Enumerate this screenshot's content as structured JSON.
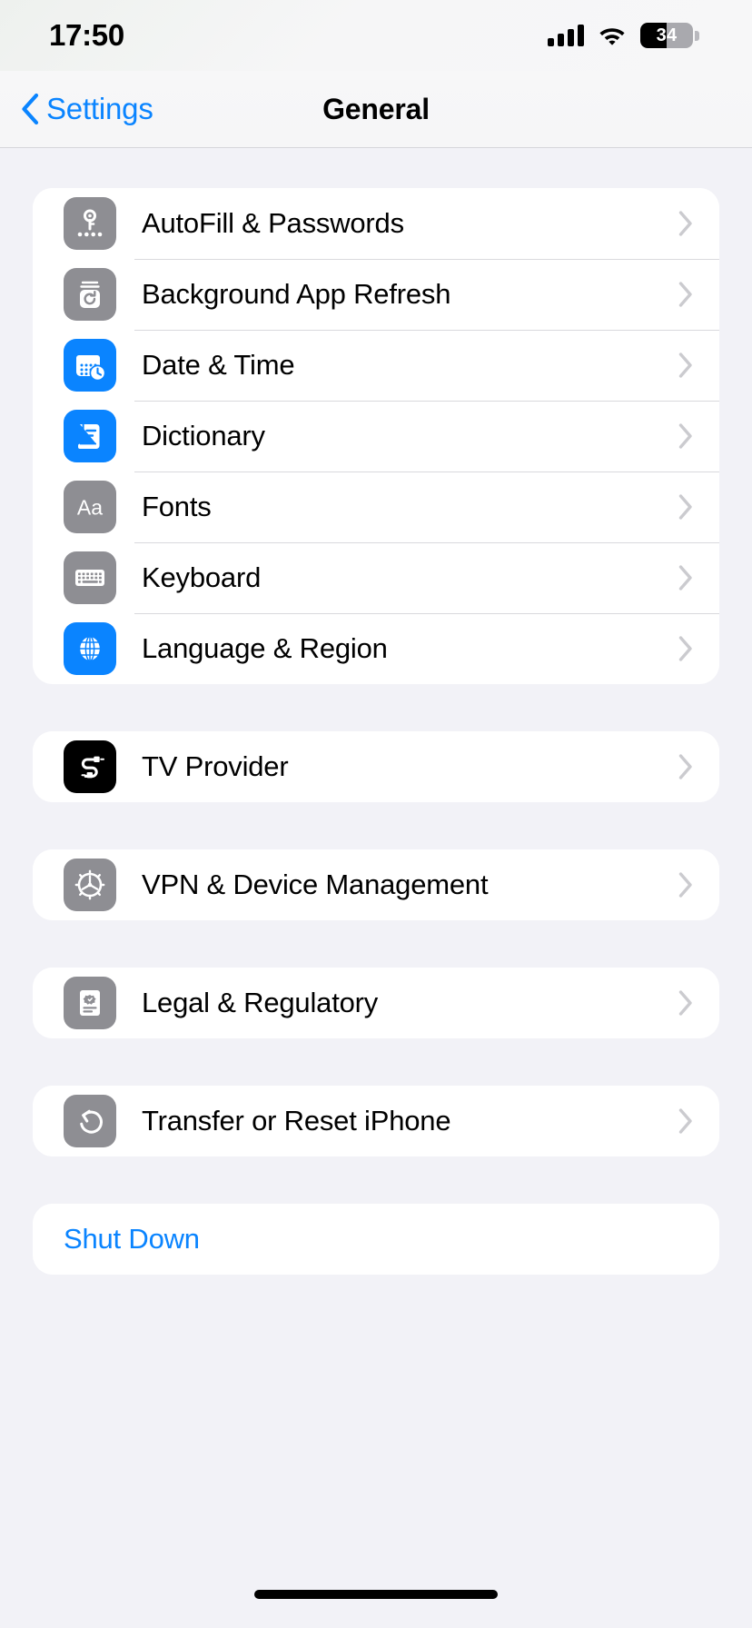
{
  "status_bar": {
    "time": "17:50",
    "signal_icon": "cellular-signal-icon",
    "wifi_icon": "wifi-icon",
    "battery_percent": "34",
    "battery_icon": "battery-icon"
  },
  "nav": {
    "back_label": "Settings",
    "back_icon": "chevron-left-icon",
    "title": "General"
  },
  "colors": {
    "accent": "#0a84ff",
    "icon_gray": "#8e8e93",
    "icon_blue": "#0a84ff",
    "icon_black": "#000000",
    "page_background": "#f2f2f7",
    "card_background": "#ffffff",
    "separator": "#d9d9dd"
  },
  "groups": [
    {
      "rows": [
        {
          "label": "AutoFill & Passwords",
          "icon": "key-icon",
          "icon_bg": "bg-gray",
          "chevron": "chevron-right-icon"
        },
        {
          "label": "Background App Refresh",
          "icon": "refresh-jar-icon",
          "icon_bg": "bg-gray",
          "chevron": "chevron-right-icon"
        },
        {
          "label": "Date & Time",
          "icon": "calendar-clock-icon",
          "icon_bg": "bg-blue",
          "chevron": "chevron-right-icon"
        },
        {
          "label": "Dictionary",
          "icon": "book-icon",
          "icon_bg": "bg-blue",
          "chevron": "chevron-right-icon"
        },
        {
          "label": "Fonts",
          "icon": "aa-text-icon",
          "icon_bg": "bg-gray",
          "chevron": "chevron-right-icon"
        },
        {
          "label": "Keyboard",
          "icon": "keyboard-icon",
          "icon_bg": "bg-gray",
          "chevron": "chevron-right-icon"
        },
        {
          "label": "Language & Region",
          "icon": "globe-icon",
          "icon_bg": "bg-blue",
          "chevron": "chevron-right-icon"
        }
      ]
    },
    {
      "rows": [
        {
          "label": "TV Provider",
          "icon": "cable-connector-icon",
          "icon_bg": "bg-black",
          "chevron": "chevron-right-icon"
        }
      ]
    },
    {
      "rows": [
        {
          "label": "VPN & Device Management",
          "icon": "gear-icon",
          "icon_bg": "bg-gray",
          "chevron": "chevron-right-icon"
        }
      ]
    },
    {
      "rows": [
        {
          "label": "Legal & Regulatory",
          "icon": "certificate-doc-icon",
          "icon_bg": "bg-gray",
          "chevron": "chevron-right-icon"
        }
      ]
    },
    {
      "rows": [
        {
          "label": "Transfer or Reset iPhone",
          "icon": "reset-arrow-icon",
          "icon_bg": "bg-gray",
          "chevron": "chevron-right-icon"
        }
      ]
    },
    {
      "rows": [
        {
          "label": "Shut Down",
          "icon": "",
          "icon_bg": "",
          "chevron": "",
          "accent": true
        }
      ]
    }
  ]
}
